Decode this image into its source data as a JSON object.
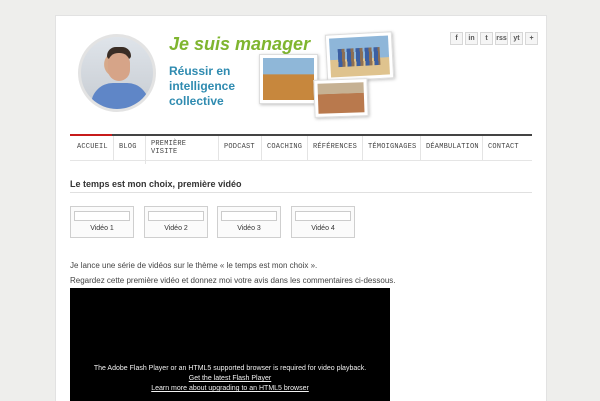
{
  "brand": {
    "title": "Je suis manager",
    "subtitle": "Réussir en intelligence collective"
  },
  "social": [
    "f",
    "in",
    "t",
    "rss",
    "yt",
    "+"
  ],
  "nav": {
    "items": [
      "ACCUEIL",
      "BLOG",
      "PREMIÈRE VISITE",
      "PODCAST",
      "COACHING",
      "RÉFÉRENCES",
      "TÉMOIGNAGES",
      "DÉAMBULATION",
      "CONTACT"
    ]
  },
  "content": {
    "title": "Le temps est mon choix, première vidéo",
    "videos": [
      "Vidéo 1",
      "Vidéo 2",
      "Vidéo 3",
      "Vidéo 4"
    ],
    "paragraph1": "Je lance une série de vidéos sur le thème « le temps est mon choix ».",
    "paragraph2": "Regardez cette première vidéo et donnez moi votre avis dans les commentaires ci-dessous."
  },
  "player": {
    "message": "The Adobe Flash Player or an HTML5 supported browser is required for video playback.",
    "link1": "Get the latest Flash Player",
    "link2": "Learn more about upgrading to an HTML5 browser"
  },
  "colors": {
    "background": "#eeeeec",
    "brand_green": "#7fb52f",
    "brand_blue": "#2f8bb0",
    "nav_accent": "#c71b1b"
  }
}
